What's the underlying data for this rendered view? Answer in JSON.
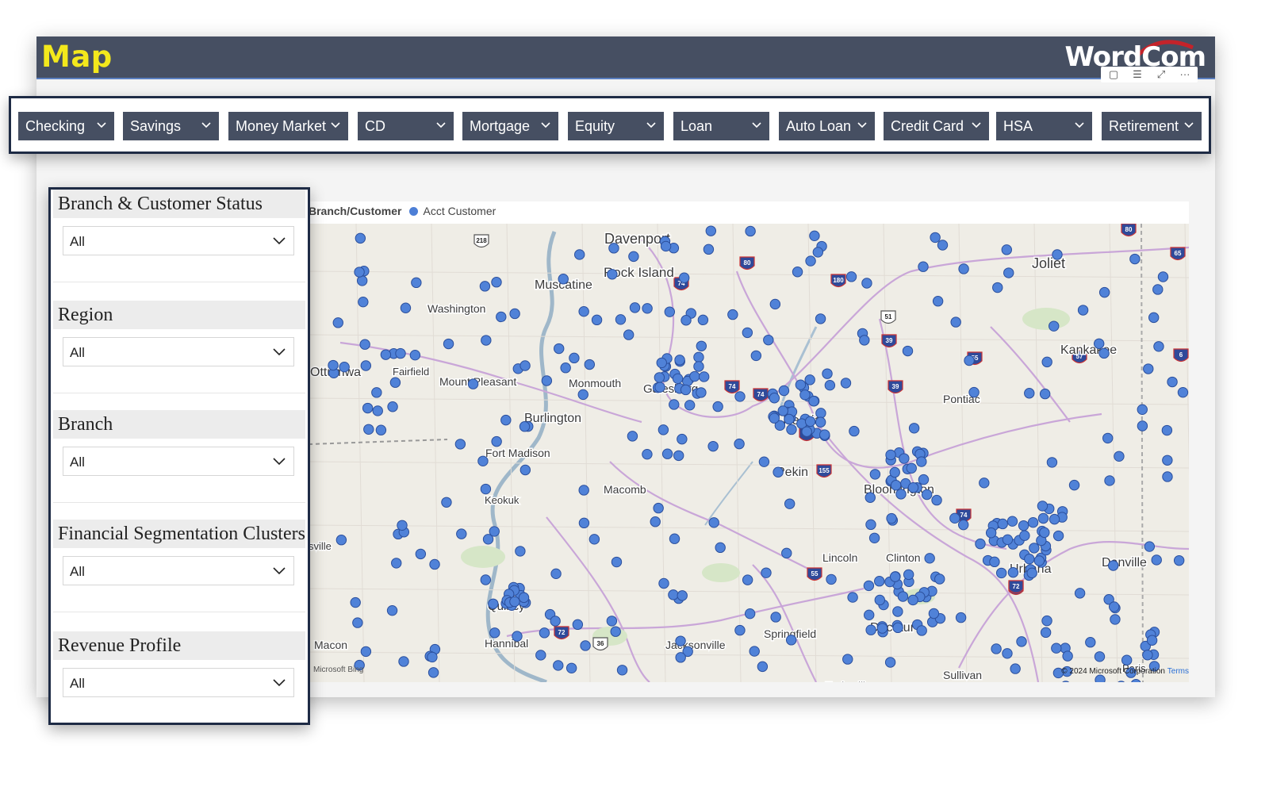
{
  "page": {
    "title": "Map",
    "logo_text": "WordCom"
  },
  "colors": {
    "header_bg": "#464f62",
    "title_color": "#f3e81c",
    "slicer_bg": "#464f62",
    "panel_border": "#1e2b45",
    "customer_dot": "#4d7fd6"
  },
  "visual_toolbar": {
    "icons": [
      "copy-icon",
      "filter-icon",
      "focus-mode-icon",
      "more-options-icon"
    ],
    "glyphs": [
      "▢",
      "☰",
      "⤢",
      "···"
    ]
  },
  "slicers": [
    {
      "label": "Checking"
    },
    {
      "label": "Savings"
    },
    {
      "label": "Money Market"
    },
    {
      "label": "CD"
    },
    {
      "label": "Mortgage"
    },
    {
      "label": "Equity"
    },
    {
      "label": "Loan"
    },
    {
      "label": "Auto Loan"
    },
    {
      "label": "Credit Card"
    },
    {
      "label": "HSA"
    },
    {
      "label": "Retirement"
    }
  ],
  "filters": [
    {
      "title": "Branch & Customer Status",
      "value": "All"
    },
    {
      "title": "Region",
      "value": "All"
    },
    {
      "title": "Branch",
      "value": "All"
    },
    {
      "title": "Financial Segmentation Clusters",
      "value": "All"
    },
    {
      "title": "Revenue Profile",
      "value": "All"
    }
  ],
  "map": {
    "legend_title": "Branch/Customer",
    "legend_item": "Acct Customer",
    "credit_left": "Microsoft Bing",
    "credit_right": "© 2024 Microsoft Corporation",
    "terms": "Terms",
    "cities": [
      "Davenport",
      "Rock Island",
      "Joliet",
      "Muscatine",
      "Washington",
      "Kankakee",
      "Ottumwa",
      "Fairfield",
      "Mount Pleasant",
      "Monmouth",
      "Galesburg",
      "Pontiac",
      "Burlington",
      "Peoria",
      "Fort Madison",
      "Pekin",
      "Bloomington",
      "Macomb",
      "Keokuk",
      "sville",
      "Lincoln",
      "Clinton",
      "Urbana",
      "Danville",
      "Quincy",
      "Decatur",
      "Macon",
      "Hannibal",
      "Jacksonville",
      "Springfield",
      "Sullivan",
      "Taylorville",
      "Paris"
    ],
    "shields": [
      "218",
      "80",
      "74",
      "180",
      "80",
      "65",
      "51",
      "39",
      "55",
      "57",
      "74",
      "74",
      "39",
      "74",
      "155",
      "74",
      "72",
      "55",
      "72",
      "36",
      "72",
      "57",
      "6"
    ]
  }
}
